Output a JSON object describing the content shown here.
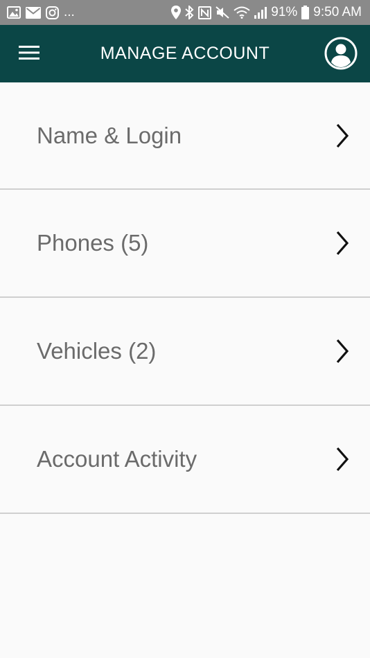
{
  "status_bar": {
    "more_indicator": "...",
    "battery": "91%",
    "time": "9:50 AM",
    "left_icons": [
      "gallery-icon",
      "mail-icon",
      "instagram-icon"
    ],
    "right_icons": [
      "location-icon",
      "bluetooth-icon",
      "nfc-icon",
      "mute-icon",
      "wifi-icon",
      "signal-icon",
      "battery-icon"
    ]
  },
  "app_bar": {
    "title": "MANAGE ACCOUNT",
    "background": "#0b4646",
    "menu_icon": "hamburger-menu-icon",
    "profile_icon": "profile-icon"
  },
  "menu": {
    "items": [
      {
        "label": "Name & Login"
      },
      {
        "label": "Phones (5)"
      },
      {
        "label": "Vehicles (2)"
      },
      {
        "label": "Account Activity"
      }
    ],
    "chevron_icon": "chevron-right-icon"
  }
}
